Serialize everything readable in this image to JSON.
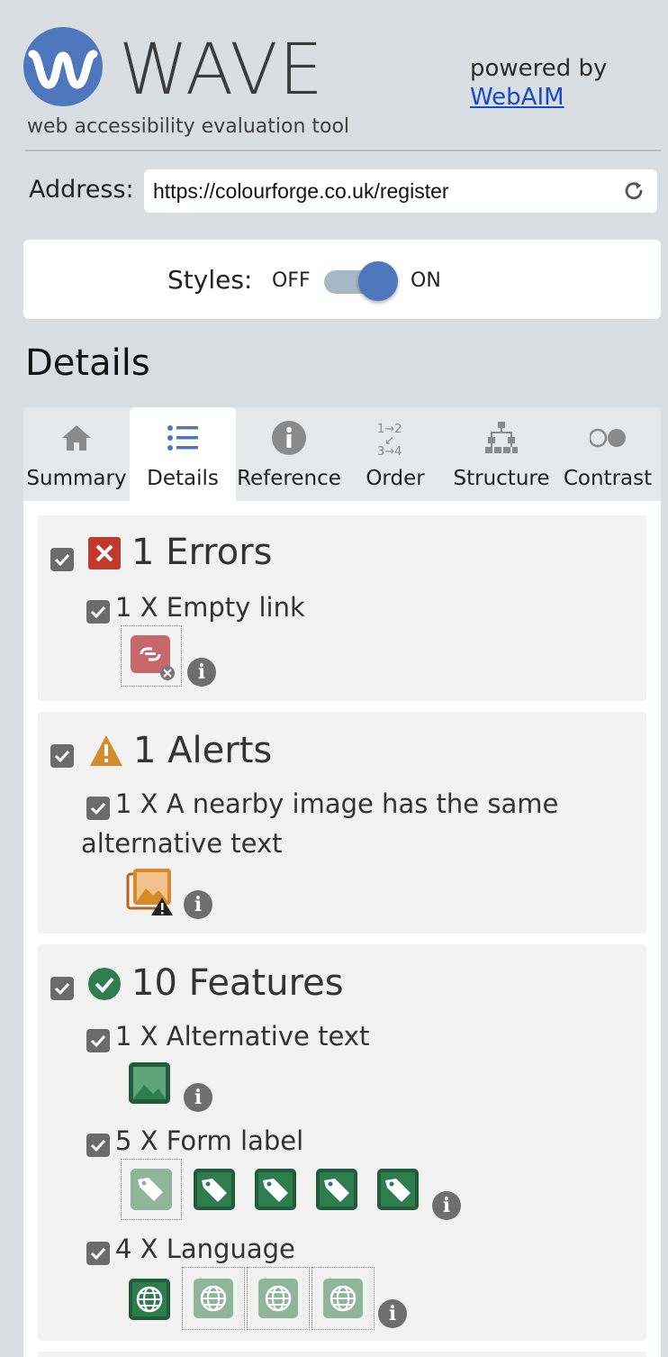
{
  "header": {
    "logo_text": "WAVE",
    "tagline": "web accessibility evaluation tool",
    "powered_by": "powered by",
    "webaim_link": "WebAIM"
  },
  "address": {
    "label": "Address:",
    "value": "https://colourforge.co.uk/register"
  },
  "styles": {
    "label": "Styles:",
    "off": "OFF",
    "on": "ON",
    "state": "on"
  },
  "details_title": "Details",
  "tabs": [
    {
      "label": "Summary",
      "icon": "home-icon"
    },
    {
      "label": "Details",
      "icon": "list-icon",
      "active": true
    },
    {
      "label": "Reference",
      "icon": "info-icon"
    },
    {
      "label": "Order",
      "icon": "order-icon"
    },
    {
      "label": "Structure",
      "icon": "structure-icon"
    },
    {
      "label": "Contrast",
      "icon": "contrast-icon"
    }
  ],
  "errors": {
    "title": "1 Errors",
    "items": [
      {
        "label": "1 X Empty link",
        "icon": "broken-link-icon"
      }
    ]
  },
  "alerts": {
    "title": "1 Alerts",
    "items": [
      {
        "label": "1 X A nearby image has the same alternative text",
        "icon": "redundant-alt-icon"
      }
    ]
  },
  "features": {
    "title": "10 Features",
    "items": [
      {
        "label": "1 X Alternative text",
        "icon": "alt-text-icon"
      },
      {
        "label": "5 X Form label",
        "icon": "form-label-icon"
      },
      {
        "label": "4 X Language",
        "icon": "language-icon"
      }
    ]
  },
  "colors": {
    "brand_blue": "#4f77bd",
    "error_red": "#c0392b",
    "alert_orange": "#d68a2a",
    "feature_green": "#2e7d4f"
  }
}
